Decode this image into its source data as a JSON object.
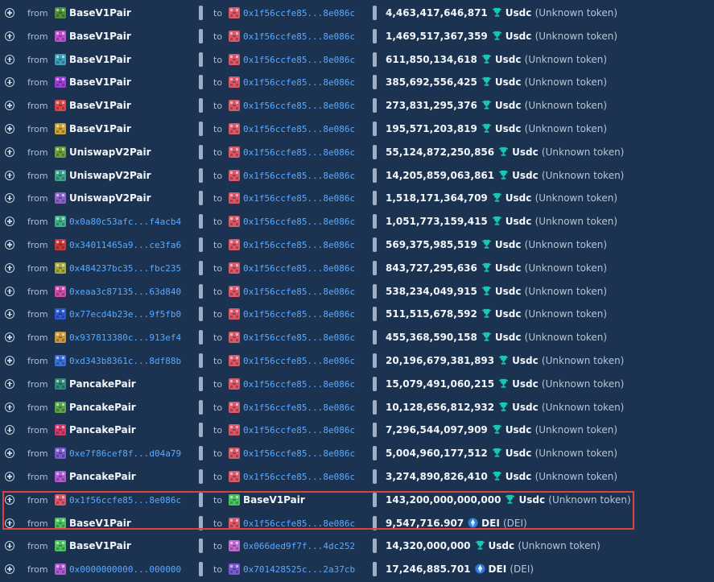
{
  "labels": {
    "from": "from",
    "to": "to"
  },
  "token_icons": {
    "usdc": "trophy-icon",
    "dei": "ethereum-diamond-icon"
  },
  "colors": {
    "background": "#1b3351",
    "address_link": "#5aa9ff",
    "highlight_border": "#e0413c"
  },
  "rows": [
    {
      "from": "BaseV1Pair",
      "from_mono": false,
      "from_color": "#4c8f3a",
      "to": "0x1f56ccfe85...8e086c",
      "to_mono": true,
      "to_color": "#d9586a",
      "amount": "4,463,417,646,871",
      "token": "Usdc",
      "note": "(Unknown token)",
      "icon": "usdc"
    },
    {
      "from": "BaseV1Pair",
      "from_mono": false,
      "from_color": "#c04fd0",
      "to": "0x1f56ccfe85...8e086c",
      "to_mono": true,
      "to_color": "#d9586a",
      "amount": "1,469,517,367,359",
      "token": "Usdc",
      "note": "(Unknown token)",
      "icon": "usdc"
    },
    {
      "from": "BaseV1Pair",
      "from_mono": false,
      "from_color": "#3aa0b8",
      "to": "0x1f56ccfe85...8e086c",
      "to_mono": true,
      "to_color": "#d9586a",
      "amount": "611,850,134,618",
      "token": "Usdc",
      "note": "(Unknown token)",
      "icon": "usdc"
    },
    {
      "from": "BaseV1Pair",
      "from_mono": false,
      "from_color": "#9a3fd6",
      "to": "0x1f56ccfe85...8e086c",
      "to_mono": true,
      "to_color": "#d9586a",
      "amount": "385,692,556,425",
      "token": "Usdc",
      "note": "(Unknown token)",
      "icon": "usdc"
    },
    {
      "from": "BaseV1Pair",
      "from_mono": false,
      "from_color": "#d94848",
      "to": "0x1f56ccfe85...8e086c",
      "to_mono": true,
      "to_color": "#d9586a",
      "amount": "273,831,295,376",
      "token": "Usdc",
      "note": "(Unknown token)",
      "icon": "usdc"
    },
    {
      "from": "BaseV1Pair",
      "from_mono": false,
      "from_color": "#c9a23a",
      "to": "0x1f56ccfe85...8e086c",
      "to_mono": true,
      "to_color": "#d9586a",
      "amount": "195,571,203,819",
      "token": "Usdc",
      "note": "(Unknown token)",
      "icon": "usdc"
    },
    {
      "from": "UniswapV2Pair",
      "from_mono": false,
      "from_color": "#6a9f3e",
      "to": "0x1f56ccfe85...8e086c",
      "to_mono": true,
      "to_color": "#d9586a",
      "amount": "55,124,872,250,856",
      "token": "Usdc",
      "note": "(Unknown token)",
      "icon": "usdc"
    },
    {
      "from": "UniswapV2Pair",
      "from_mono": false,
      "from_color": "#3f9f8a",
      "to": "0x1f56ccfe85...8e086c",
      "to_mono": true,
      "to_color": "#d9586a",
      "amount": "14,205,859,063,861",
      "token": "Usdc",
      "note": "(Unknown token)",
      "icon": "usdc"
    },
    {
      "from": "UniswapV2Pair",
      "from_mono": false,
      "from_color": "#8a63c9",
      "to": "0x1f56ccfe85...8e086c",
      "to_mono": true,
      "to_color": "#d9586a",
      "amount": "1,518,171,364,709",
      "token": "Usdc",
      "note": "(Unknown token)",
      "icon": "usdc"
    },
    {
      "from": "0x0a80c53afc...f4acb4",
      "from_mono": true,
      "from_color": "#3fae8a",
      "to": "0x1f56ccfe85...8e086c",
      "to_mono": true,
      "to_color": "#d9586a",
      "amount": "1,051,773,159,415",
      "token": "Usdc",
      "note": "(Unknown token)",
      "icon": "usdc"
    },
    {
      "from": "0x34011465a9...ce3fa6",
      "from_mono": true,
      "from_color": "#c43a3a",
      "to": "0x1f56ccfe85...8e086c",
      "to_mono": true,
      "to_color": "#d9586a",
      "amount": "569,375,985,519",
      "token": "Usdc",
      "note": "(Unknown token)",
      "icon": "usdc"
    },
    {
      "from": "0x484237bc35...fbc235",
      "from_mono": true,
      "from_color": "#a4a93a",
      "to": "0x1f56ccfe85...8e086c",
      "to_mono": true,
      "to_color": "#d9586a",
      "amount": "843,727,295,636",
      "token": "Usdc",
      "note": "(Unknown token)",
      "icon": "usdc"
    },
    {
      "from": "0xeaa3c87135...63d840",
      "from_mono": true,
      "from_color": "#d04aa8",
      "to": "0x1f56ccfe85...8e086c",
      "to_mono": true,
      "to_color": "#d9586a",
      "amount": "538,234,049,915",
      "token": "Usdc",
      "note": "(Unknown token)",
      "icon": "usdc"
    },
    {
      "from": "0x77ecd4b23e...9f5fb0",
      "from_mono": true,
      "from_color": "#2f57d4",
      "to": "0x1f56ccfe85...8e086c",
      "to_mono": true,
      "to_color": "#d9586a",
      "amount": "511,515,678,592",
      "token": "Usdc",
      "note": "(Unknown token)",
      "icon": "usdc"
    },
    {
      "from": "0x937813380c...913ef4",
      "from_mono": true,
      "from_color": "#c9983a",
      "to": "0x1f56ccfe85...8e086c",
      "to_mono": true,
      "to_color": "#d9586a",
      "amount": "455,368,590,158",
      "token": "Usdc",
      "note": "(Unknown token)",
      "icon": "usdc"
    },
    {
      "from": "0xd343b8361c...8df88b",
      "from_mono": true,
      "from_color": "#3a6fd4",
      "to": "0x1f56ccfe85...8e086c",
      "to_mono": true,
      "to_color": "#d9586a",
      "amount": "20,196,679,381,893",
      "token": "Usdc",
      "note": "(Unknown token)",
      "icon": "usdc"
    },
    {
      "from": "PancakePair",
      "from_mono": false,
      "from_color": "#2f8a7a",
      "to": "0x1f56ccfe85...8e086c",
      "to_mono": true,
      "to_color": "#d9586a",
      "amount": "15,079,491,060,215",
      "token": "Usdc",
      "note": "(Unknown token)",
      "icon": "usdc"
    },
    {
      "from": "PancakePair",
      "from_mono": false,
      "from_color": "#5aa54a",
      "to": "0x1f56ccfe85...8e086c",
      "to_mono": true,
      "to_color": "#d9586a",
      "amount": "10,128,656,812,932",
      "token": "Usdc",
      "note": "(Unknown token)",
      "icon": "usdc"
    },
    {
      "from": "PancakePair",
      "from_mono": false,
      "from_color": "#d03a6a",
      "to": "0x1f56ccfe85...8e086c",
      "to_mono": true,
      "to_color": "#d9586a",
      "amount": "7,296,544,097,909",
      "token": "Usdc",
      "note": "(Unknown token)",
      "icon": "usdc"
    },
    {
      "from": "0xe7f86cef8f...d04a79",
      "from_mono": true,
      "from_color": "#7a5ad0",
      "to": "0x1f56ccfe85...8e086c",
      "to_mono": true,
      "to_color": "#d9586a",
      "amount": "5,004,960,177,512",
      "token": "Usdc",
      "note": "(Unknown token)",
      "icon": "usdc"
    },
    {
      "from": "PancakePair",
      "from_mono": false,
      "from_color": "#b05ad0",
      "to": "0x1f56ccfe85...8e086c",
      "to_mono": true,
      "to_color": "#d9586a",
      "amount": "3,274,890,826,410",
      "token": "Usdc",
      "note": "(Unknown token)",
      "icon": "usdc"
    },
    {
      "from": "0x1f56ccfe85...8e086c",
      "from_mono": true,
      "from_color": "#d9586a",
      "to": "BaseV1Pair",
      "to_mono": false,
      "to_color": "#4cc05a",
      "amount": "143,200,000,000,000",
      "token": "Usdc",
      "note": "(Unknown token)",
      "icon": "usdc"
    },
    {
      "from": "BaseV1Pair",
      "from_mono": false,
      "from_color": "#4cc05a",
      "to": "0x1f56ccfe85...8e086c",
      "to_mono": true,
      "to_color": "#d9586a",
      "amount": "9,547,716.907",
      "token": "DEI",
      "note": "(DEI)",
      "icon": "dei"
    },
    {
      "from": "BaseV1Pair",
      "from_mono": false,
      "from_color": "#4cc05a",
      "to": "0x066ded9f7f...4dc252",
      "to_mono": true,
      "to_color": "#c06ad0",
      "amount": "14,320,000,000",
      "token": "Usdc",
      "note": "(Unknown token)",
      "icon": "usdc"
    },
    {
      "from": "0x0000000000...000000",
      "from_mono": true,
      "from_color": "#b05ad0",
      "to": "0x701428525c...2a37cb",
      "to_mono": true,
      "to_color": "#7a5ad0",
      "amount": "17,246,885.701",
      "token": "DEI",
      "note": "(DEI)",
      "icon": "dei"
    }
  ]
}
